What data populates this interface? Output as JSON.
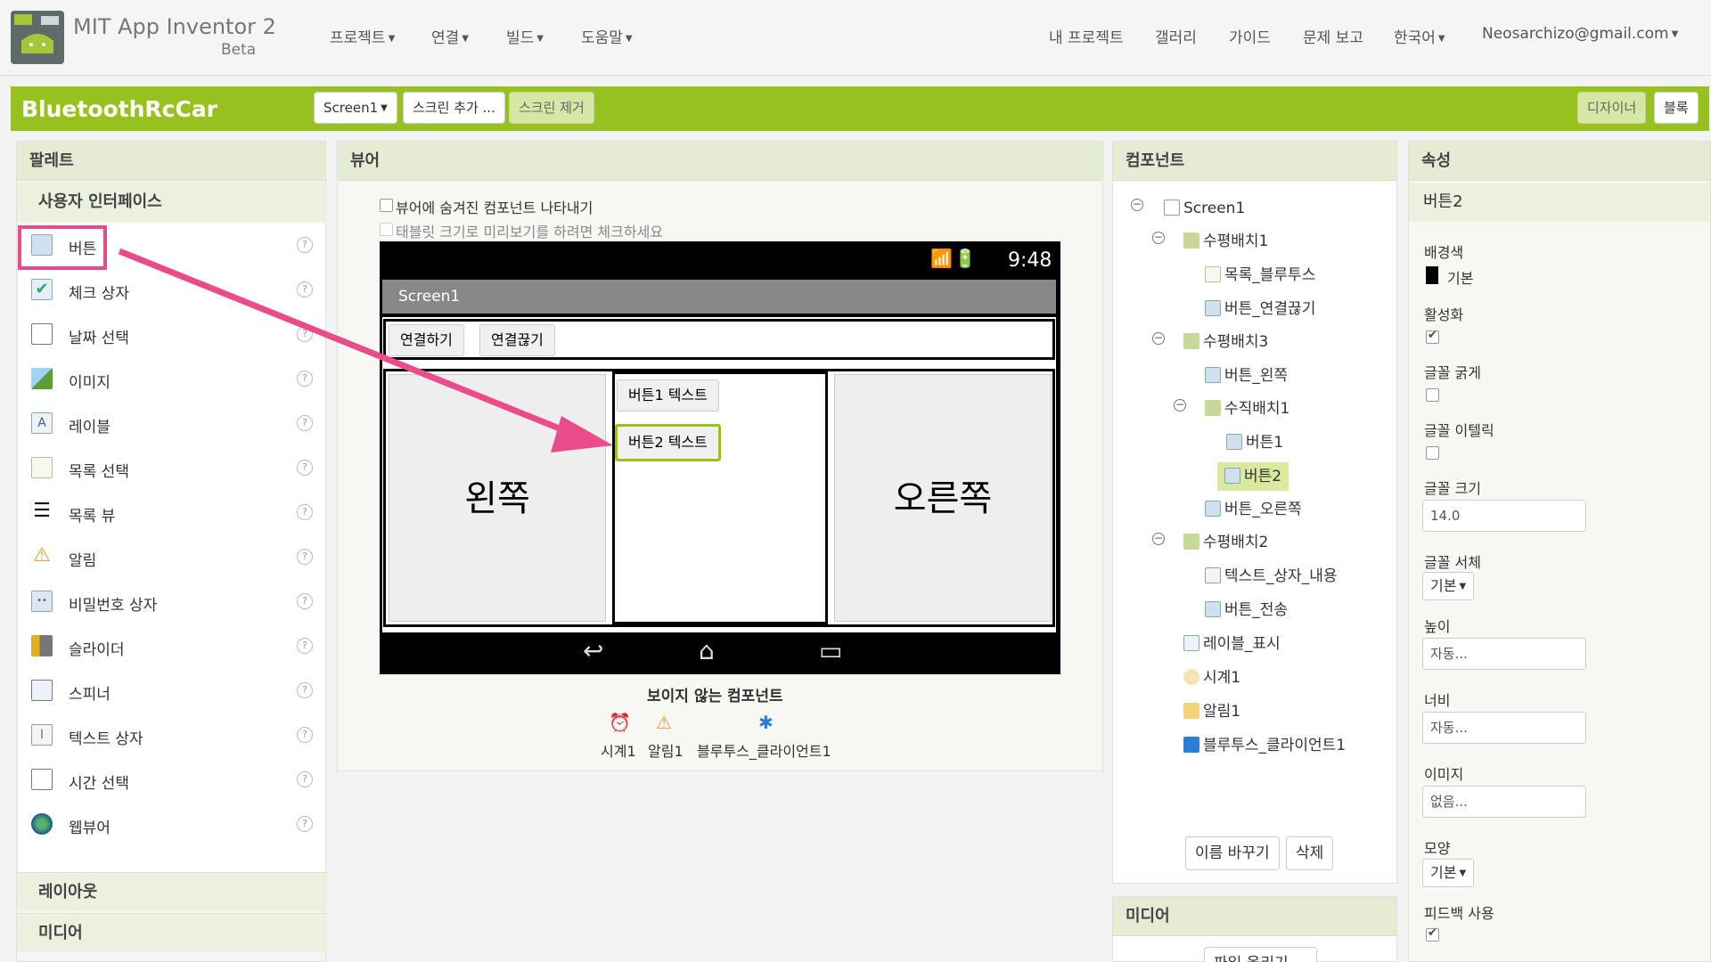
{
  "app": {
    "title": "MIT App Inventor 2",
    "subtitle": "Beta"
  },
  "topnav": {
    "left": [
      "프로젝트",
      "연결",
      "빌드",
      "도움말"
    ],
    "right": [
      "내 프로젝트",
      "갤러리",
      "가이드",
      "문제 보고"
    ],
    "language": "한국어",
    "account": "Neosarchizo@gmail.com"
  },
  "toolbar": {
    "project": "BluetoothRcCar",
    "screen_select": "Screen1",
    "add_screen": "스크린 추가 ...",
    "remove_screen": "스크린 제거",
    "designer": "디자이너",
    "blocks": "블록"
  },
  "palette": {
    "title": "팔레트",
    "section": "사용자 인터페이스",
    "items": [
      {
        "label": "버튼",
        "icon": "button-icon"
      },
      {
        "label": "체크 상자",
        "icon": "checkbox-icon"
      },
      {
        "label": "날짜 선택",
        "icon": "calendar-icon"
      },
      {
        "label": "이미지",
        "icon": "image-icon"
      },
      {
        "label": "레이블",
        "icon": "label-icon"
      },
      {
        "label": "목록 선택",
        "icon": "list-picker-icon"
      },
      {
        "label": "목록 뷰",
        "icon": "list-view-icon"
      },
      {
        "label": "알림",
        "icon": "notifier-icon"
      },
      {
        "label": "비밀번호 상자",
        "icon": "password-icon"
      },
      {
        "label": "슬라이더",
        "icon": "slider-icon"
      },
      {
        "label": "스피너",
        "icon": "spinner-icon"
      },
      {
        "label": "텍스트 상자",
        "icon": "textbox-icon"
      },
      {
        "label": "시간 선택",
        "icon": "time-icon"
      },
      {
        "label": "웹뷰어",
        "icon": "webviewer-icon"
      }
    ],
    "help": "?",
    "sections_below": [
      "레이아웃",
      "미디어"
    ]
  },
  "viewer": {
    "title": "뷰어",
    "show_hidden": "뷰어에 숨겨진 컴포넌트 나타내기",
    "tablet_preview": "태블릿 크기로 미리보기를 하려면 체크하세요",
    "status_time": "9:48",
    "screen_title": "Screen1",
    "connect_button": "연결하기",
    "disconnect_button": "연결끊기",
    "left_label": "왼쪽",
    "right_label": "오른쪽",
    "button1": "버튼1 텍스트",
    "button2": "버튼2 텍스트",
    "nonvisible_title": "보이지 않는 컴포넌트",
    "nonvisible": [
      {
        "label": "시계1",
        "icon": "clock-icon"
      },
      {
        "label": "알림1",
        "icon": "notifier-icon"
      },
      {
        "label": "블루투스_클라이언트1",
        "icon": "bluetooth-icon"
      }
    ]
  },
  "components": {
    "title": "컴포넌트",
    "tree": [
      {
        "label": "Screen1",
        "toggle": "⊟"
      },
      {
        "label": "수평배치1",
        "toggle": "⊟"
      },
      {
        "label": "목록_블루투스"
      },
      {
        "label": "버튼_연결끊기"
      },
      {
        "label": "수평배치3",
        "toggle": "⊟"
      },
      {
        "label": "버튼_왼쪽"
      },
      {
        "label": "수직배치1",
        "toggle": "⊟"
      },
      {
        "label": "버튼1"
      },
      {
        "label": "버튼2"
      },
      {
        "label": "버튼_오른쪽"
      },
      {
        "label": "수평배치2",
        "toggle": "⊟"
      },
      {
        "label": "텍스트_상자_내용"
      },
      {
        "label": "버튼_전송"
      },
      {
        "label": "레이블_표시"
      },
      {
        "label": "시계1"
      },
      {
        "label": "알림1"
      },
      {
        "label": "블루투스_클라이언트1"
      }
    ],
    "rename": "이름 바꾸기",
    "delete": "삭제",
    "media_title": "미디어",
    "upload": "파일 올리기 ..."
  },
  "properties": {
    "title": "속성",
    "component": "버튼2",
    "bgcolor_label": "배경색",
    "bgcolor_value": "기본",
    "enabled_label": "활성화",
    "bold_label": "글꼴 굵게",
    "italic_label": "글꼴 이텔릭",
    "fontsize_label": "글꼴 크기",
    "fontsize_value": "14.0",
    "fontface_label": "글꼴 서체",
    "fontface_value": "기본",
    "height_label": "높이",
    "height_value": "자동...",
    "width_label": "너비",
    "width_value": "자동...",
    "image_label": "이미지",
    "image_value": "없음...",
    "shape_label": "모양",
    "shape_value": "기본",
    "feedback_label": "피드백 사용"
  },
  "colors": {
    "accent": "#97c11f",
    "highlight": "#ea4c89"
  }
}
